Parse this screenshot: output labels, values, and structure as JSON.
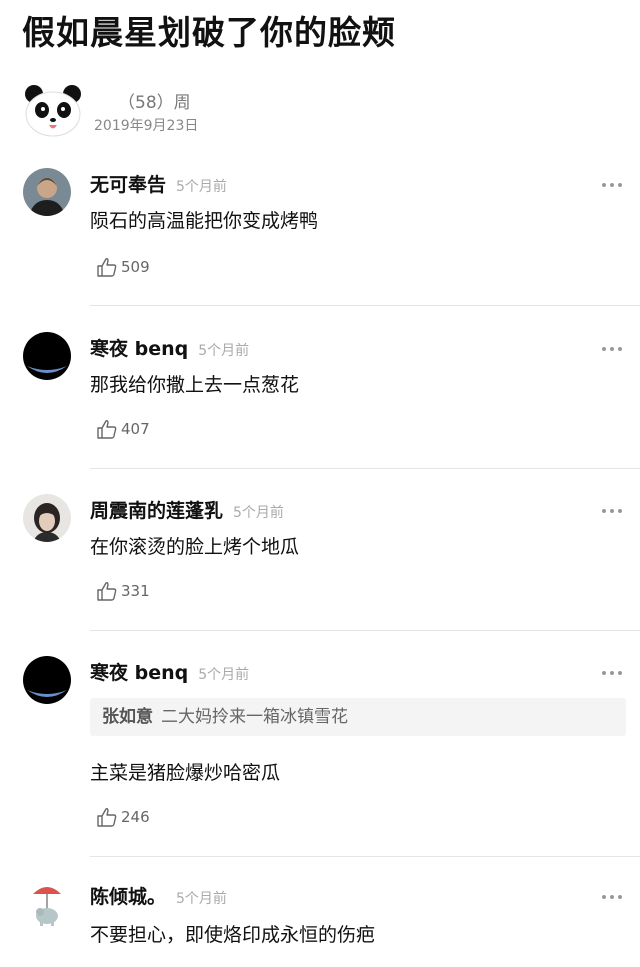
{
  "post": {
    "title": "假如晨星划破了你的脸颊",
    "author": "（58）周",
    "date": "2019年9月23日",
    "author_avatar_icon": "panda-icon"
  },
  "comments": [
    {
      "user": "无可奉告",
      "time": "5个月前",
      "text": "陨石的高温能把你变成烤鸭",
      "likes": "509",
      "avatar": "photo-avatar"
    },
    {
      "user": "寒夜 benq",
      "time": "5个月前",
      "text": "那我给你撒上去一点葱花",
      "likes": "407",
      "avatar": "planet-avatar"
    },
    {
      "user": "周震南的莲蓬乳",
      "time": "5个月前",
      "text": "在你滚烫的脸上烤个地瓜",
      "likes": "331",
      "avatar": "photo-avatar"
    },
    {
      "user": "寒夜 benq",
      "time": "5个月前",
      "reply_to": "张如意",
      "reply_text": "二大妈拎来一箱冰镇雪花",
      "text": "主菜是猪脸爆炒哈密瓜",
      "likes": "246",
      "avatar": "planet-avatar"
    },
    {
      "user": "陈倾城。",
      "time": "5个月前",
      "text": "不要担心，即使烙印成永恒的伤疤",
      "avatar": "elephant-umbrella-avatar"
    }
  ],
  "icons": {
    "like": "thumbs-up-icon",
    "more": "more-dots-icon"
  }
}
